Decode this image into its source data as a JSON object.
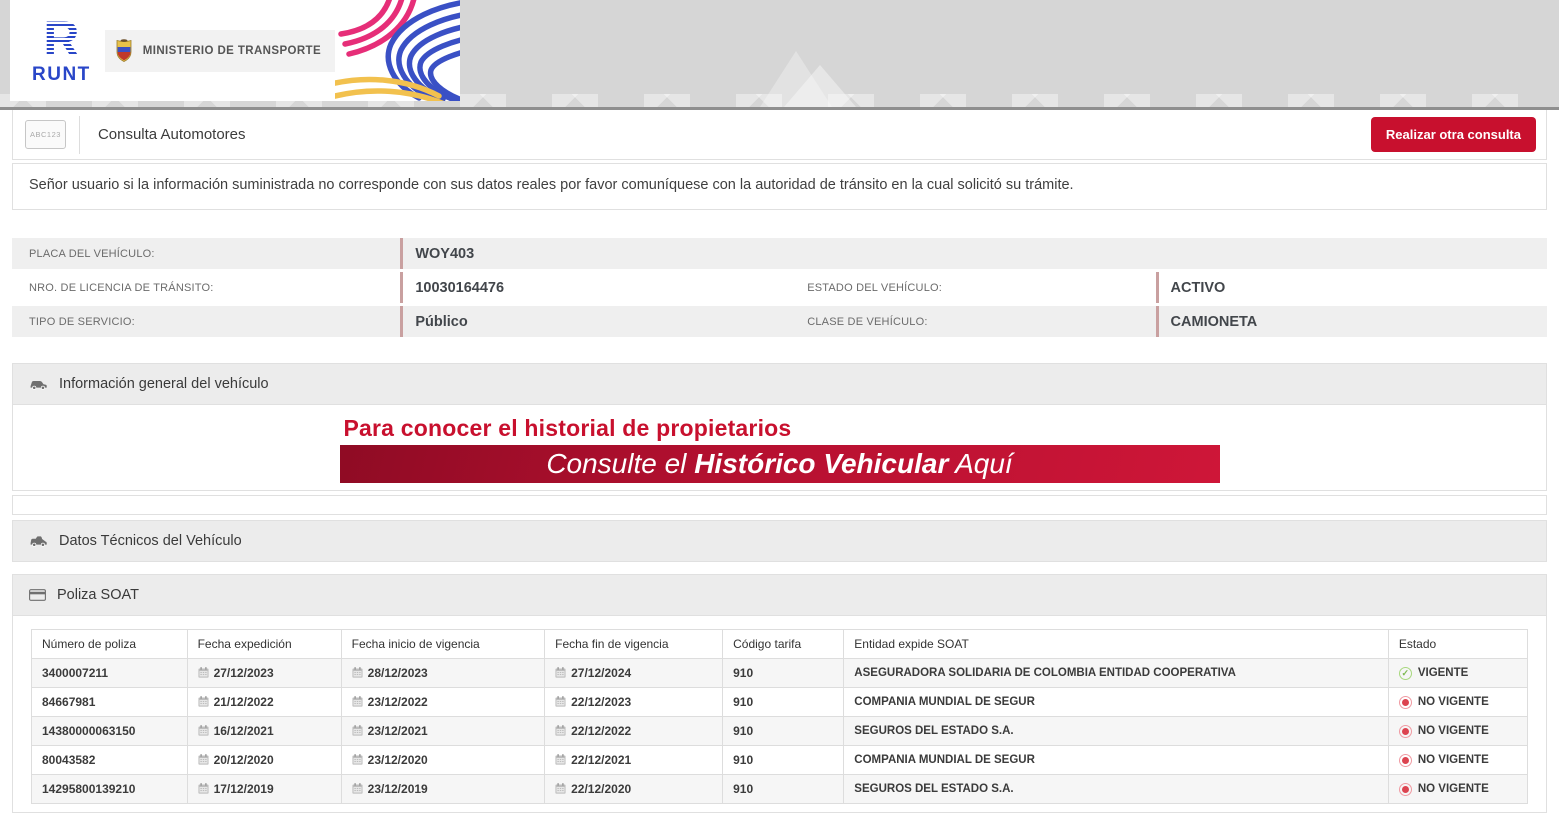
{
  "header": {
    "runt_monogram": "R",
    "runt_name": "RUNT",
    "ministry_label": "MINISTERIO DE TRANSPORTE"
  },
  "toolbar": {
    "plate_icon_text": "ABC123",
    "title": "Consulta Automotores",
    "new_query_button": "Realizar otra consulta"
  },
  "notice": "Señor usuario si la información suministrada no corresponde con sus datos reales por favor comuníquese con la autoridad de tránsito en la cual solicitó su trámite.",
  "vehicle": {
    "plate_label": "PLACA DEL VEHÍCULO:",
    "plate_value": "WOY403",
    "license_label": "NRO. DE LICENCIA DE TRÁNSITO:",
    "license_value": "10030164476",
    "state_label": "ESTADO DEL VEHÍCULO:",
    "state_value": "ACTIVO",
    "service_label": "TIPO DE SERVICIO:",
    "service_value": "Público",
    "class_label": "CLASE DE VEHÍCULO:",
    "class_value": "CAMIONETA"
  },
  "sections": {
    "general_info": "Información general del vehículo",
    "technical_data": "Datos Técnicos del Vehículo",
    "soat_policy": "Poliza SOAT"
  },
  "banner": {
    "line1": "Para conocer el historial de propietarios",
    "line2_prefix": "Consulte el ",
    "line2_bold": "Histórico Vehicular",
    "line2_suffix": " Aquí"
  },
  "soat_table": {
    "columns": [
      "Número de poliza",
      "Fecha expedición",
      "Fecha inicio de vigencia",
      "Fecha fin de vigencia",
      "Código tarifa",
      "Entidad expide SOAT",
      "Estado"
    ],
    "rows": [
      {
        "policy": "3400007211",
        "issued": "27/12/2023",
        "start": "28/12/2023",
        "end": "27/12/2024",
        "tariff": "910",
        "entity": "ASEGURADORA SOLIDARIA DE COLOMBIA ENTIDAD COOPERATIVA",
        "status": "VIGENTE",
        "status_type": "active"
      },
      {
        "policy": "84667981",
        "issued": "21/12/2022",
        "start": "23/12/2022",
        "end": "22/12/2023",
        "tariff": "910",
        "entity": "COMPANIA MUNDIAL DE SEGUR",
        "status": "NO VIGENTE",
        "status_type": "inactive"
      },
      {
        "policy": "14380000063150",
        "issued": "16/12/2021",
        "start": "23/12/2021",
        "end": "22/12/2022",
        "tariff": "910",
        "entity": "SEGUROS DEL ESTADO S.A.",
        "status": "NO VIGENTE",
        "status_type": "inactive"
      },
      {
        "policy": "80043582",
        "issued": "20/12/2020",
        "start": "23/12/2020",
        "end": "22/12/2021",
        "tariff": "910",
        "entity": "COMPANIA MUNDIAL DE SEGUR",
        "status": "NO VIGENTE",
        "status_type": "inactive"
      },
      {
        "policy": "14295800139210",
        "issued": "17/12/2019",
        "start": "23/12/2019",
        "end": "22/12/2020",
        "tariff": "910",
        "entity": "SEGUROS DEL ESTADO S.A.",
        "status": "NO VIGENTE",
        "status_type": "inactive"
      }
    ]
  },
  "colors": {
    "accent_red": "#c8102e",
    "status_active": "#7cb950",
    "status_inactive": "#dc4450"
  }
}
